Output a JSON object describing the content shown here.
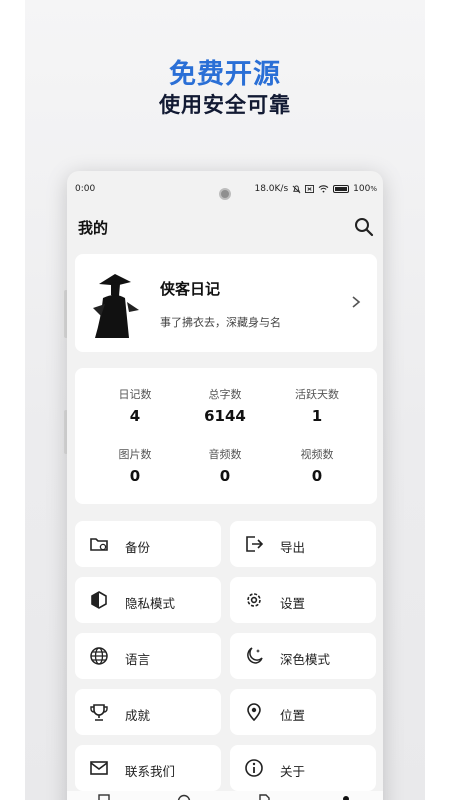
{
  "promo": {
    "headline": "免费开源",
    "subheadline": "使用安全可靠"
  },
  "status_bar": {
    "time": "0:00",
    "net_speed": "18.0K/s",
    "battery": "100"
  },
  "header": {
    "title": "我的"
  },
  "profile": {
    "name": "侠客日记",
    "motto": "事了拂衣去，深藏身与名"
  },
  "stats": [
    {
      "label": "日记数",
      "value": "4"
    },
    {
      "label": "总字数",
      "value": "6144"
    },
    {
      "label": "活跃天数",
      "value": "1"
    },
    {
      "label": "图片数",
      "value": "0"
    },
    {
      "label": "音频数",
      "value": "0"
    },
    {
      "label": "视频数",
      "value": "0"
    }
  ],
  "menu": [
    {
      "label": "备份",
      "icon": "folder-sync-icon"
    },
    {
      "label": "导出",
      "icon": "export-icon"
    },
    {
      "label": "隐私模式",
      "icon": "privacy-icon"
    },
    {
      "label": "设置",
      "icon": "gear-icon"
    },
    {
      "label": "语言",
      "icon": "globe-icon"
    },
    {
      "label": "深色模式",
      "icon": "moon-icon"
    },
    {
      "label": "成就",
      "icon": "trophy-icon"
    },
    {
      "label": "位置",
      "icon": "location-pin-icon"
    },
    {
      "label": "联系我们",
      "icon": "mail-icon"
    },
    {
      "label": "关于",
      "icon": "info-icon"
    }
  ],
  "colors": {
    "accent": "#2a6fd6",
    "dark_heading": "#121a33",
    "card": "#ffffff",
    "screen_bg": "#f2f2f2"
  }
}
